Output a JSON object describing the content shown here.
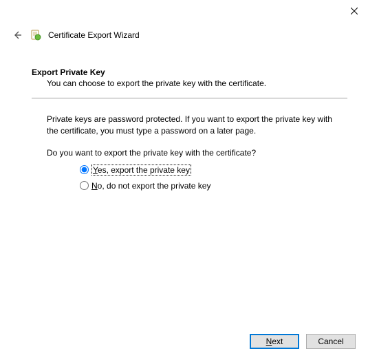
{
  "window": {
    "title": "Certificate Export Wizard"
  },
  "page": {
    "heading": "Export Private Key",
    "subheading": "You can choose to export the private key with the certificate.",
    "info": "Private keys are password protected. If you want to export the private key with the certificate, you must type a password on a later page.",
    "question": "Do you want to export the private key with the certificate?"
  },
  "options": {
    "yes_prefix": "Y",
    "yes_rest": "es, export the private key",
    "no_prefix": "N",
    "no_rest": "o, do not export the private key",
    "selected": "yes"
  },
  "buttons": {
    "next_prefix": "N",
    "next_rest": "ext",
    "cancel": "Cancel"
  }
}
